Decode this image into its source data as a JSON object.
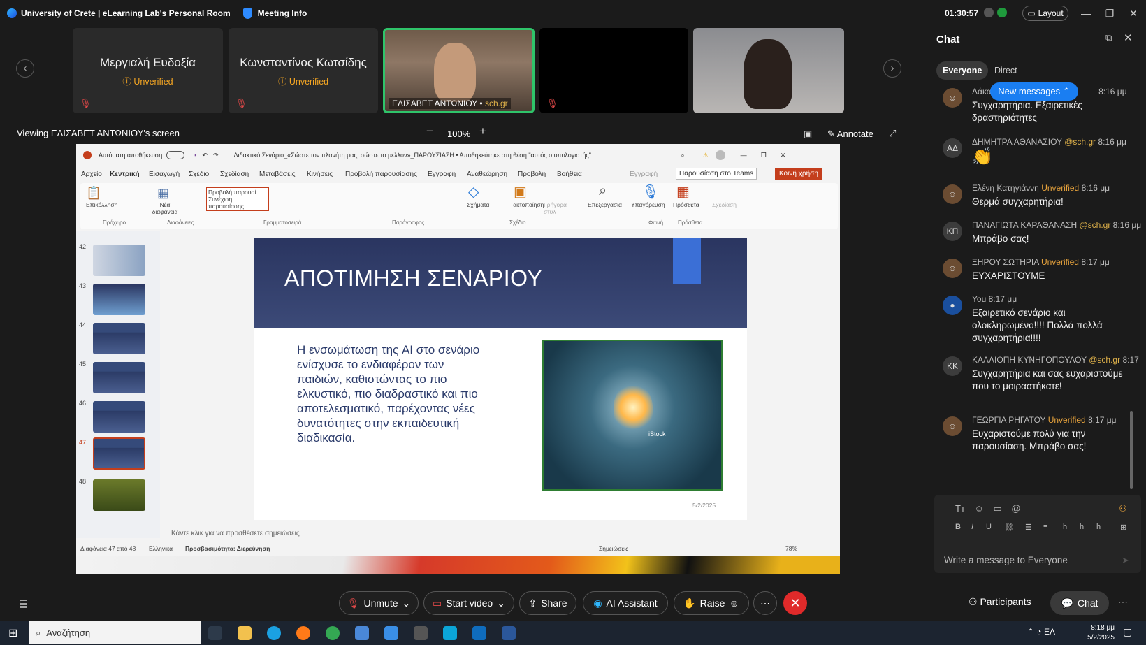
{
  "titlebar": {
    "room": "University of Crete | eLearning Lab's Personal Room",
    "meeting_info": "Meeting Info",
    "clock": "01:30:57",
    "layout": "Layout"
  },
  "participants": [
    {
      "name": "Μεργιαλή Ευδοξία",
      "status": "Unverified"
    },
    {
      "name": "Κωνσταντίνος Κωτσίδης",
      "status": "Unverified"
    },
    {
      "name": "ΕΛΙΣΑΒΕΤ ΑΝΤΩΝΙΟΥ",
      "domain": "sch.gr"
    }
  ],
  "share": {
    "viewing": "Viewing ΕΛΙΣΑΒΕΤ ΑΝΤΩΝΙΟΥ's screen",
    "zoom": "100%",
    "annotate": "Annotate"
  },
  "ppt": {
    "autosave": "Αυτόματη αποθήκευση",
    "doc_title": "Διδακτικό Σενάριο_«Σώστε τον πλανήτη μας, σώστε το μέλλον»_ΠΑΡΟΥΣΙΑΣΗ • Αποθηκεύτηκε στη θέση \"αυτός ο υπολογιστής\"",
    "menu": [
      "Αρχείο",
      "Κεντρική",
      "Εισαγωγή",
      "Σχέδιο",
      "Σχεδίαση",
      "Μεταβάσεις",
      "Κινήσεις",
      "Προβολή παρουσίασης",
      "Εγγραφή",
      "Αναθεώρηση",
      "Προβολή",
      "Βοήθεια"
    ],
    "record": "Εγγραφή",
    "teams": "Παρουσίαση στο Teams",
    "share_btn": "Κοινή χρήση",
    "ribbon": {
      "paste": "Επικόλληση",
      "new_slide": "Νέα διαφάνεια",
      "view_dropdown": "Προβολή παρουσί",
      "continue": "Συνέχιση παρουσίασης",
      "shapes": "Σχήματα",
      "arrange": "Τακτοποίηση",
      "quick_styles": "Γρήγορα στυλ",
      "editing": "Επεξεργασία",
      "dictate": "Υπαγόρευση",
      "addins": "Πρόσθετα",
      "designer": "Σχεδίαση"
    },
    "groups": [
      "Πρόχειρο",
      "Διαφάνειες",
      "Γραμματοσειρά",
      "Παράγραφος",
      "Σχέδιο",
      "Φωνή",
      "Πρόσθετα"
    ],
    "thumbs": [
      "42",
      "43",
      "44",
      "45",
      "46",
      "47",
      "48"
    ],
    "slide": {
      "title": "ΑΠΟΤΙΜΗΣΗ ΣΕΝΑΡΙΟΥ",
      "body": "Η ενσωμάτωση της AI στο σενάριο ενίσχυσε το ενδιαφέρον των παιδιών, καθιστώντας το πιο ελκυστικό, πιο διαδραστικό και πιο αποτελεσματικό, παρέχοντας νέες δυνατότητες στην εκπαιδευτική διαδικασία.",
      "image_caption": "iStock",
      "date": "5/2/2025"
    },
    "notes": "Κάντε κλικ για να προσθέσετε σημειώσεις",
    "status": {
      "slide_count": "Διαφάνεια 47 από 48",
      "language": "Ελληνικά",
      "accessibility": "Προσβασιμότητα: Διερεύνηση",
      "notes_btn": "Σημειώσεις",
      "zoom": "78%"
    }
  },
  "chat": {
    "title": "Chat",
    "tabs": [
      "Everyone",
      "Direct"
    ],
    "new_messages": "New messages",
    "messages": [
      {
        "avatar": "",
        "sender": "Δάκα",
        "tag": "",
        "time": "8:16 μμ",
        "text": "Συγχαρητήρια. Εξαιρετικές δραστηριότητες"
      },
      {
        "avatar": "ΑΔ",
        "sender": "ΔΗΜΗΤΡΑ ΑΘΑΝΑΣΙΟΥ",
        "tag": "@sch.gr",
        "time": "8:16 μμ",
        "text": "👏"
      },
      {
        "avatar": "",
        "sender": "Ελένη Κατηγιάννη",
        "tag": "Unverified",
        "time": "8:16 μμ",
        "text": "Θερμά συγχαρητήρια!"
      },
      {
        "avatar": "ΚΠ",
        "sender": "ΠΑΝΑΓΙΩΤΑ ΚΑΡΑΘΑΝΑΣΗ",
        "tag": "@sch.gr",
        "time": "8:16 μμ",
        "text": "Μπράβο σας!"
      },
      {
        "avatar": "",
        "sender": "ΞΗΡΟΥ ΣΩΤΗΡΙΑ",
        "tag": "Unverified",
        "time": "8:17 μμ",
        "text": "ΕΥΧΑΡΙΣΤΟΥΜΕ"
      },
      {
        "avatar": "",
        "sender": "You",
        "tag": "",
        "time": "8:17 μμ",
        "text": "Εξαιρετικό σενάριο και ολοκληρωμένο!!!! Πολλά πολλά συγχαρητήρια!!!!"
      },
      {
        "avatar": "KK",
        "sender": "ΚΑΛΛΙΟΠΗ ΚΥΝΗΓΟΠΟΥΛΟΥ",
        "tag": "@sch.gr",
        "time": "8:17",
        "text": "Συγχαρητήρια και σας ευχαριστούμε που το μοιραστήκατε!"
      },
      {
        "avatar": "",
        "sender": "ΓΕΩΡΓΙΑ ΡΗΓΑΤΟΥ",
        "tag": "Unverified",
        "time": "8:17 μμ",
        "text": "Ευχαριστούμε πολύ για την παρουσίαση. Μπράβο σας!"
      }
    ],
    "placeholder": "Write a message to Everyone"
  },
  "controls": {
    "unmute": "Unmute",
    "start_video": "Start video",
    "share": "Share",
    "ai": "AI Assistant",
    "raise": "Raise",
    "participants": "Participants",
    "chat": "Chat"
  },
  "taskbar": {
    "search": "Αναζήτηση",
    "lang": "ΕΛ",
    "time": "8:18 μμ",
    "date": "5/2/2025"
  },
  "colors": {
    "accent_blue": "#1a7ef2",
    "leave_red": "#e02a2a",
    "unverified": "#e6a23c",
    "ppt_red": "#c43e1c"
  }
}
